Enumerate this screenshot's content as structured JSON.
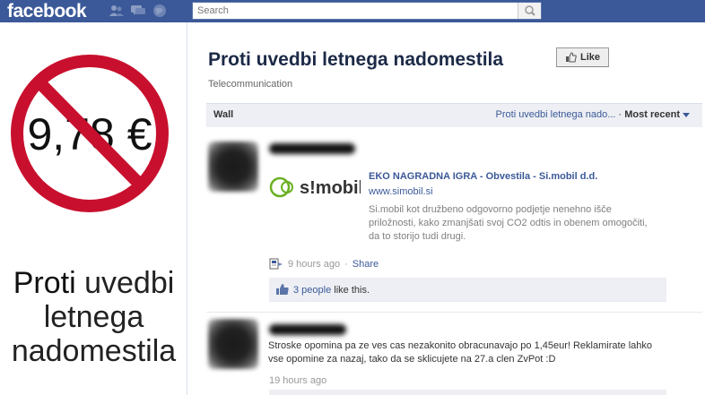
{
  "topbar": {
    "logo": "facebook",
    "search_placeholder": "Search",
    "icons": [
      "friend-requests-icon",
      "messages-icon",
      "notifications-icon",
      "search-icon"
    ]
  },
  "profile_image": {
    "price_text": "9,78 €",
    "line1_bold": "Proti",
    "line1_rest": " uvedbi",
    "line2": "letnega",
    "line3": "nadomestila",
    "colors": {
      "ring": "#c8102e"
    }
  },
  "page": {
    "title": "Proti uvedbi letnega nadomestila",
    "like_label": "Like",
    "category": "Telecommunication"
  },
  "wall": {
    "label": "Wall",
    "filter_link": "Proti uvedbi letnega nado...",
    "separator": "·",
    "sort_label": "Most recent"
  },
  "post1": {
    "attachment": {
      "logo_text": "s!mobil",
      "title": "EKO NAGRADNA IGRA - Obvestila - Si.mobil d.d.",
      "url": "www.simobil.si",
      "description": "Si.mobil kot družbeno odgovorno podjetje nenehno išče priložnosti, kako zmanjšati svoj CO2 odtis in obenem omogočiti, da to storijo tudi drugi."
    },
    "time": "9 hours ago",
    "dot": "·",
    "share": "Share",
    "likes_count_link": "3 people",
    "likes_suffix": " like this."
  },
  "post2": {
    "text": "Stroske opomina pa ze ves cas nezakonito obracunavajo po 1,45eur! Reklamirate lahko vse opomine za nazaj, tako da se sklicujete na 27.a clen ZvPot :D",
    "time": "19 hours ago"
  },
  "colors": {
    "brand": "#3b5998",
    "link": "#3b5998",
    "wall_bg": "#edeff4",
    "simobil_green": "#6ab023"
  }
}
